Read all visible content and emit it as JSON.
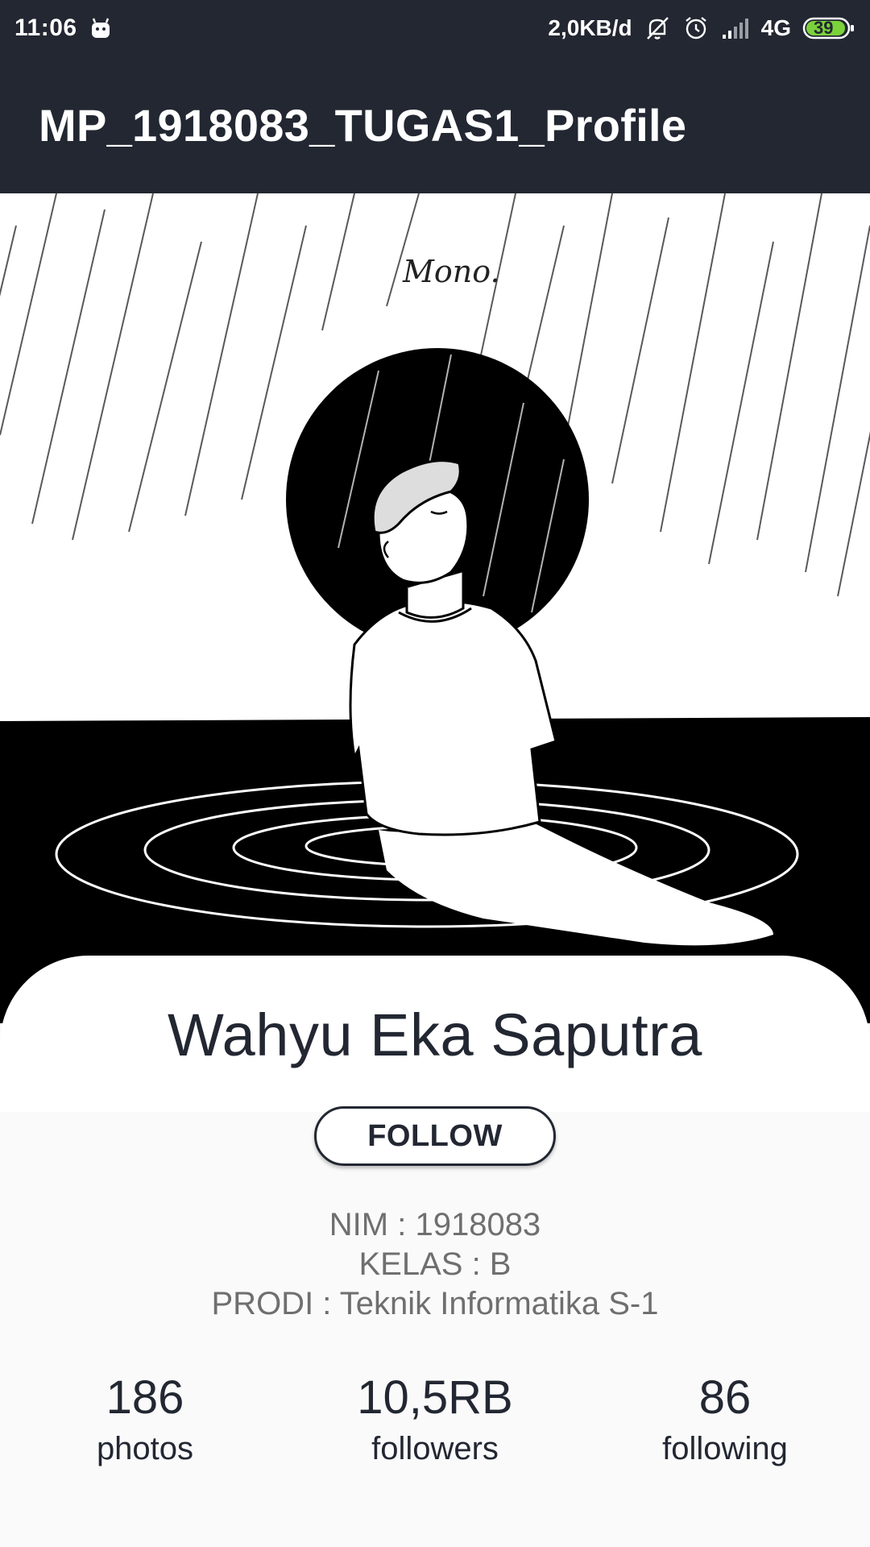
{
  "status_bar": {
    "time": "11:06",
    "network_speed": "2,0KB/d",
    "network_type": "4G",
    "battery": "39",
    "icons": [
      "android-notification-icon",
      "mute-bell-icon",
      "alarm-icon",
      "signal-icon",
      "battery-icon"
    ]
  },
  "app_bar": {
    "title": "MP_1918083_TUGAS1_Profile"
  },
  "hero": {
    "signature": "Mono."
  },
  "profile": {
    "name": "Wahyu Eka Saputra",
    "follow_label": "FOLLOW",
    "nim": "NIM : 1918083",
    "kelas": "KELAS : B",
    "prodi": "PRODI : Teknik Informatika S-1"
  },
  "stats": [
    {
      "value": "186",
      "label": "photos"
    },
    {
      "value": "10,5RB",
      "label": "followers"
    },
    {
      "value": "86",
      "label": "following"
    }
  ],
  "colors": {
    "bar": "#222732",
    "text_dark": "#222732",
    "text_gray": "#6f6f6f",
    "background": "#fafafa",
    "battery_green": "#7bd23a"
  }
}
